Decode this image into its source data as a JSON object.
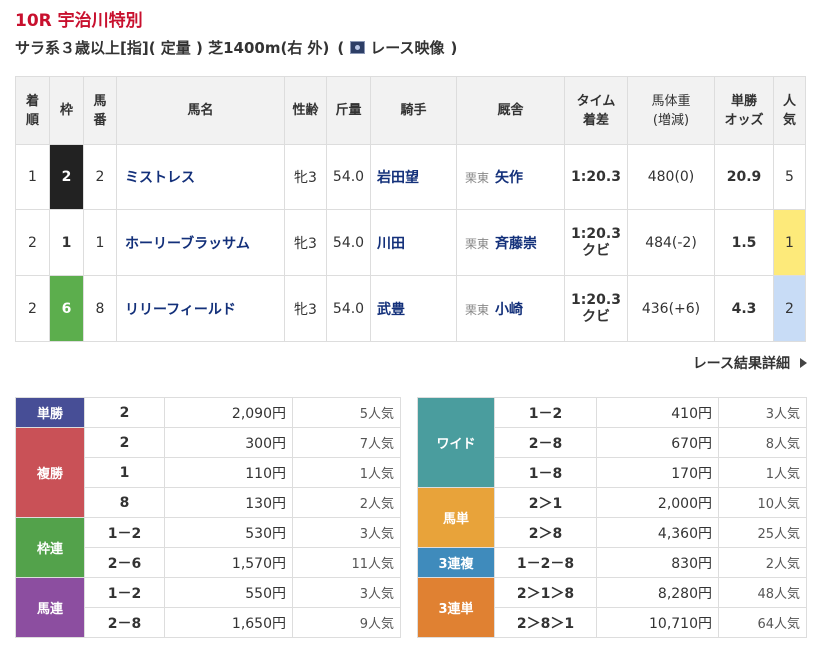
{
  "race": {
    "title": "10R 宇治川特別",
    "conditions": "サラ系３歳以上[指]( 定量 ) 芝1400m(右 外)",
    "paren_open": "(",
    "video_label": "レース映像",
    "paren_close": ")"
  },
  "results_table": {
    "headers": {
      "rank": "着\n順",
      "waku": "枠",
      "umaban": "馬\n番",
      "horse": "馬名",
      "sex_age": "性齢",
      "weight": "斤量",
      "jockey": "騎手",
      "trainer": "厩舎",
      "time": "タイム\n着差",
      "body_weight": "馬体重\n(増減)",
      "odds": "単勝\nオッズ",
      "popularity": "人\n気"
    },
    "rows": [
      {
        "rank": "1",
        "waku": "2",
        "umaban": "2",
        "horse": "ミストレス",
        "sex_age": "牝3",
        "weight": "54.0",
        "jockey": "岩田望",
        "belong": "栗東",
        "trainer": "矢作",
        "time": "1:20.3",
        "margin": "",
        "body_weight": "480(0)",
        "odds": "20.9",
        "popularity": "5"
      },
      {
        "rank": "2",
        "waku": "1",
        "umaban": "1",
        "horse": "ホーリーブラッサム",
        "sex_age": "牝3",
        "weight": "54.0",
        "jockey": "川田",
        "belong": "栗東",
        "trainer": "斉藤崇",
        "time": "1:20.3",
        "margin": "クビ",
        "body_weight": "484(-2)",
        "odds": "1.5",
        "popularity": "1"
      },
      {
        "rank": "2",
        "waku": "6",
        "umaban": "8",
        "horse": "リリーフィールド",
        "sex_age": "牝3",
        "weight": "54.0",
        "jockey": "武豊",
        "belong": "栗東",
        "trainer": "小崎",
        "time": "1:20.3",
        "margin": "クビ",
        "body_weight": "436(+6)",
        "odds": "4.3",
        "popularity": "2"
      }
    ]
  },
  "detail_link": "レース結果詳細",
  "payouts_left": {
    "tansho": {
      "label": "単勝",
      "rows": [
        {
          "combo": "2",
          "amount": "2,090円",
          "pop": "5人気"
        }
      ]
    },
    "fukusho": {
      "label": "複勝",
      "rows": [
        {
          "combo": "2",
          "amount": "300円",
          "pop": "7人気"
        },
        {
          "combo": "1",
          "amount": "110円",
          "pop": "1人気"
        },
        {
          "combo": "8",
          "amount": "130円",
          "pop": "2人気"
        }
      ]
    },
    "wakuren": {
      "label": "枠連",
      "rows": [
        {
          "combo": "1－2",
          "amount": "530円",
          "pop": "3人気"
        },
        {
          "combo": "2－6",
          "amount": "1,570円",
          "pop": "11人気"
        }
      ]
    },
    "umaren": {
      "label": "馬連",
      "rows": [
        {
          "combo": "1－2",
          "amount": "550円",
          "pop": "3人気"
        },
        {
          "combo": "2－8",
          "amount": "1,650円",
          "pop": "9人気"
        }
      ]
    }
  },
  "payouts_right": {
    "wide": {
      "label": "ワイド",
      "rows": [
        {
          "combo": "1－2",
          "amount": "410円",
          "pop": "3人気"
        },
        {
          "combo": "2－8",
          "amount": "670円",
          "pop": "8人気"
        },
        {
          "combo": "1－8",
          "amount": "170円",
          "pop": "1人気"
        }
      ]
    },
    "umatan": {
      "label": "馬単",
      "rows": [
        {
          "combo": "2＞1",
          "amount": "2,000円",
          "pop": "10人気"
        },
        {
          "combo": "2＞8",
          "amount": "4,360円",
          "pop": "25人気"
        }
      ]
    },
    "sanrenpuku": {
      "label": "3連複",
      "rows": [
        {
          "combo": "1－2－8",
          "amount": "830円",
          "pop": "2人気"
        }
      ]
    },
    "sanrentan": {
      "label": "3連単",
      "rows": [
        {
          "combo": "2＞1＞8",
          "amount": "8,280円",
          "pop": "48人気"
        },
        {
          "combo": "2＞8＞1",
          "amount": "10,710円",
          "pop": "64人気"
        }
      ]
    }
  }
}
